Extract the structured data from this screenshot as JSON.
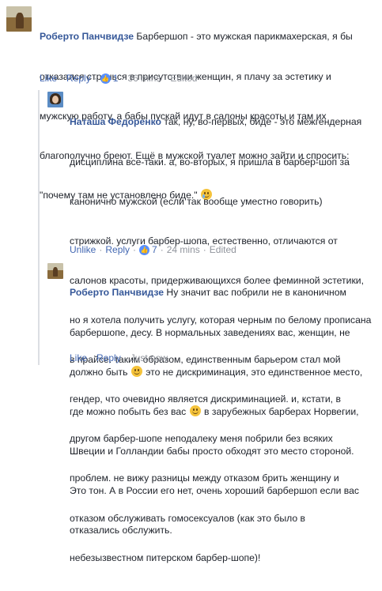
{
  "comments": [
    {
      "author": "Роберто Панчвидзе",
      "lines": [
        " Барбершоп - это мужская парикмахерская, я бы",
        "отказался стричься в присутствии женщин, я плачу за эстетику и",
        "мужскую работу, а бабы пускай идут в салоны красоты и там их",
        "благополучно бреют. Ещё в мужской туалет можно зайти и спросить:",
        "\"почему там не установлено биде.\""
      ],
      "end_emoji": "crying-laughing-emoji",
      "actions": {
        "like": "Like",
        "reply": "Reply",
        "like_count": "1",
        "time": "36 mins",
        "edited": "Edited"
      }
    },
    {
      "author": "Наташа Федоренко",
      "lines": [
        " так, ну, во-первых, биде - это межгендерная",
        "дисциплина все-таки. а, во-вторых, я пришла в барбер-шоп за",
        "канонично мужской (если так вообще уместно говорить)",
        "стрижкой. услуги барбер-шопа, естественно, отличаются от",
        "салонов красоты, придерживающихся более феминной эстетики,",
        "но я хотела получить услугу, которая черным по белому прописана",
        "в прайсе. таким образом, единственным барьером стал мой",
        "гендер, что очевидно является дискриминацией. и, кстати, в",
        "другом барбер-шопе неподалеку меня побрили без всяких",
        "проблем. не вижу разницы между отказом брить женщину и",
        "отказом обслуживать гомосексуалов (как это было в",
        "небезызвестном питерском барбер-шопе)!"
      ],
      "actions": {
        "like": "Unlike",
        "reply": "Reply",
        "like_count": "7",
        "time": "24 mins",
        "edited": "Edited"
      }
    },
    {
      "author": "Роберто Панчвидзе",
      "line1": " Ну значит вас побрили не в каноничном",
      "line2": "барбершопе, десу. В нормальных заведениях вас, женщин, не",
      "line3_a": "должно быть",
      "line3_b": " это не дискриминация, это единственное место,",
      "line4_a": "где можно побыть без вас",
      "line4_b": " в зарубежных барберах Норвегии,",
      "line5": "Швеции и Голландии бабы просто обходят это место стороной.",
      "line6": "Это тон. А в России его нет, очень хороший барбершоп если вас",
      "line7": "отказались обслужить.",
      "actions": {
        "like": "Like",
        "reply": "Reply",
        "time": "Just now"
      }
    }
  ],
  "colors": {
    "author": "#365899",
    "link": "#4267b2",
    "muted": "#90949c",
    "like_badge": "#5890ff"
  }
}
